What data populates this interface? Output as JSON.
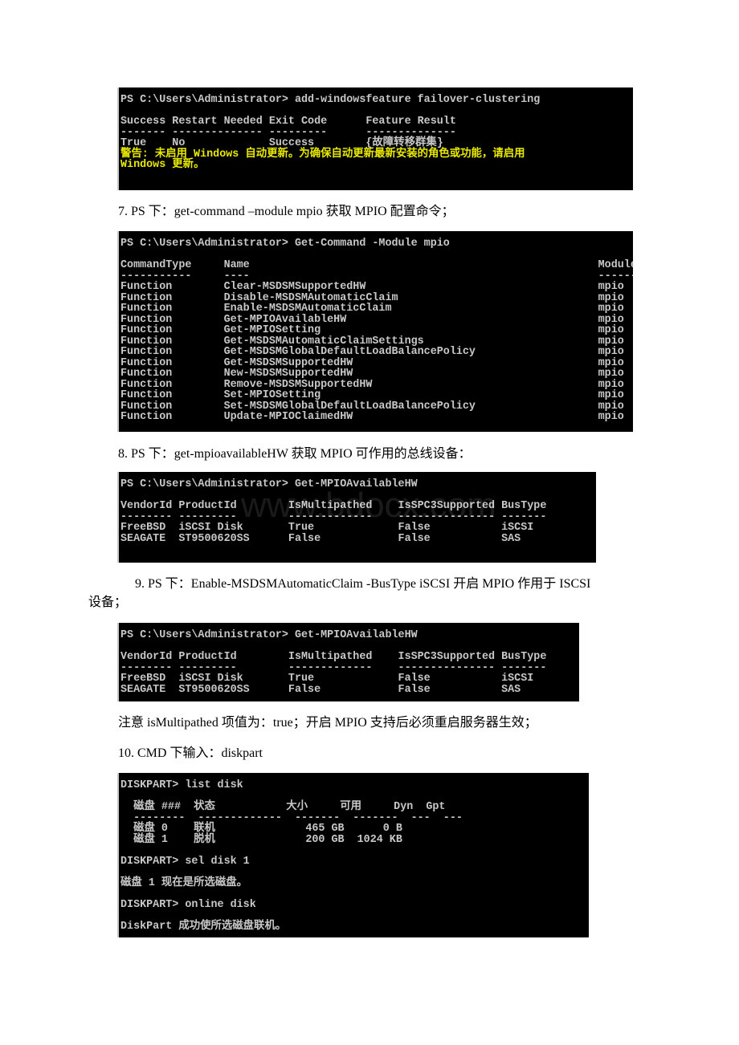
{
  "blocks": [
    {
      "lines": [
        "PS C:\\Users\\Administrator> add-windowsfeature failover-clustering",
        "",
        "Success Restart Needed Exit Code      Feature Result",
        "------- -------------- ---------      --------------",
        "True    No             Success        {故障转移群集}"
      ],
      "warning_lines": [
        "警告: 未启用 Windows 自动更新。为确保自动更新最新安装的角色或功能，请启用",
        "Windows 更新。"
      ]
    },
    {
      "caption": "7. PS 下：get-command –module mpio 获取 MPIO 配置命令；",
      "lines": [
        "PS C:\\Users\\Administrator> Get-Command -Module mpio",
        "",
        "CommandType     Name                                                      ModuleName",
        "-----------     ----                                                      ----------",
        "Function        Clear-MSDSMSupportedHW                                    mpio",
        "Function        Disable-MSDSMAutomaticClaim                               mpio",
        "Function        Enable-MSDSMAutomaticClaim                                mpio",
        "Function        Get-MPIOAvailableHW                                       mpio",
        "Function        Get-MPIOSetting                                           mpio",
        "Function        Get-MSDSMAutomaticClaimSettings                           mpio",
        "Function        Get-MSDSMGlobalDefaultLoadBalancePolicy                   mpio",
        "Function        Get-MSDSMSupportedHW                                      mpio",
        "Function        New-MSDSMSupportedHW                                      mpio",
        "Function        Remove-MSDSMSupportedHW                                   mpio",
        "Function        Set-MPIOSetting                                           mpio",
        "Function        Set-MSDSMGlobalDefaultLoadBalancePolicy                   mpio",
        "Function        Update-MPIOClaimedHW                                      mpio"
      ]
    },
    {
      "caption": "8. PS 下：get-mpioavailableHW 获取 MPIO 可作用的总线设备：",
      "watermark": "www.bdocx.com",
      "lines": [
        "PS C:\\Users\\Administrator> Get-MPIOAvailableHW",
        "",
        "VendorId ProductId        IsMultipathed    IsSPC3Supported BusType",
        "-------- ---------        -------------    --------------- -------",
        "FreeBSD  iSCSI Disk       True             False           iSCSI",
        "SEAGATE  ST9500620SS      False            False           SAS"
      ]
    },
    {
      "caption": "9. PS 下：Enable-MSDSMAutomaticClaim -BusType iSCSI 开启 MPIO 作用于 ISCSI",
      "caption_cont": "设备；",
      "lines": [
        "PS C:\\Users\\Administrator> Get-MPIOAvailableHW",
        "",
        "VendorId ProductId        IsMultipathed    IsSPC3Supported BusType",
        "-------- ---------        -------------    --------------- -------",
        "FreeBSD  iSCSI Disk       True             False           iSCSI",
        "SEAGATE  ST9500620SS      False            False           SAS"
      ]
    },
    {
      "note": "注意 isMultipathed 项值为：true；开启 MPIO 支持后必须重启服务器生效；",
      "caption": "10. CMD 下输入：diskpart",
      "lines": [
        "DISKPART> list disk",
        "",
        "  磁盘 ###  状态           大小     可用     Dyn  Gpt",
        "  --------  -------------  -------  -------  ---  ---",
        "  磁盘 0    联机              465 GB      0 B",
        "  磁盘 1    脱机              200 GB  1024 KB",
        "",
        "DISKPART> sel disk 1",
        "",
        "磁盘 1 现在是所选磁盘。",
        "",
        "DISKPART> online disk",
        "",
        "DiskPart 成功使所选磁盘联机。"
      ]
    }
  ]
}
